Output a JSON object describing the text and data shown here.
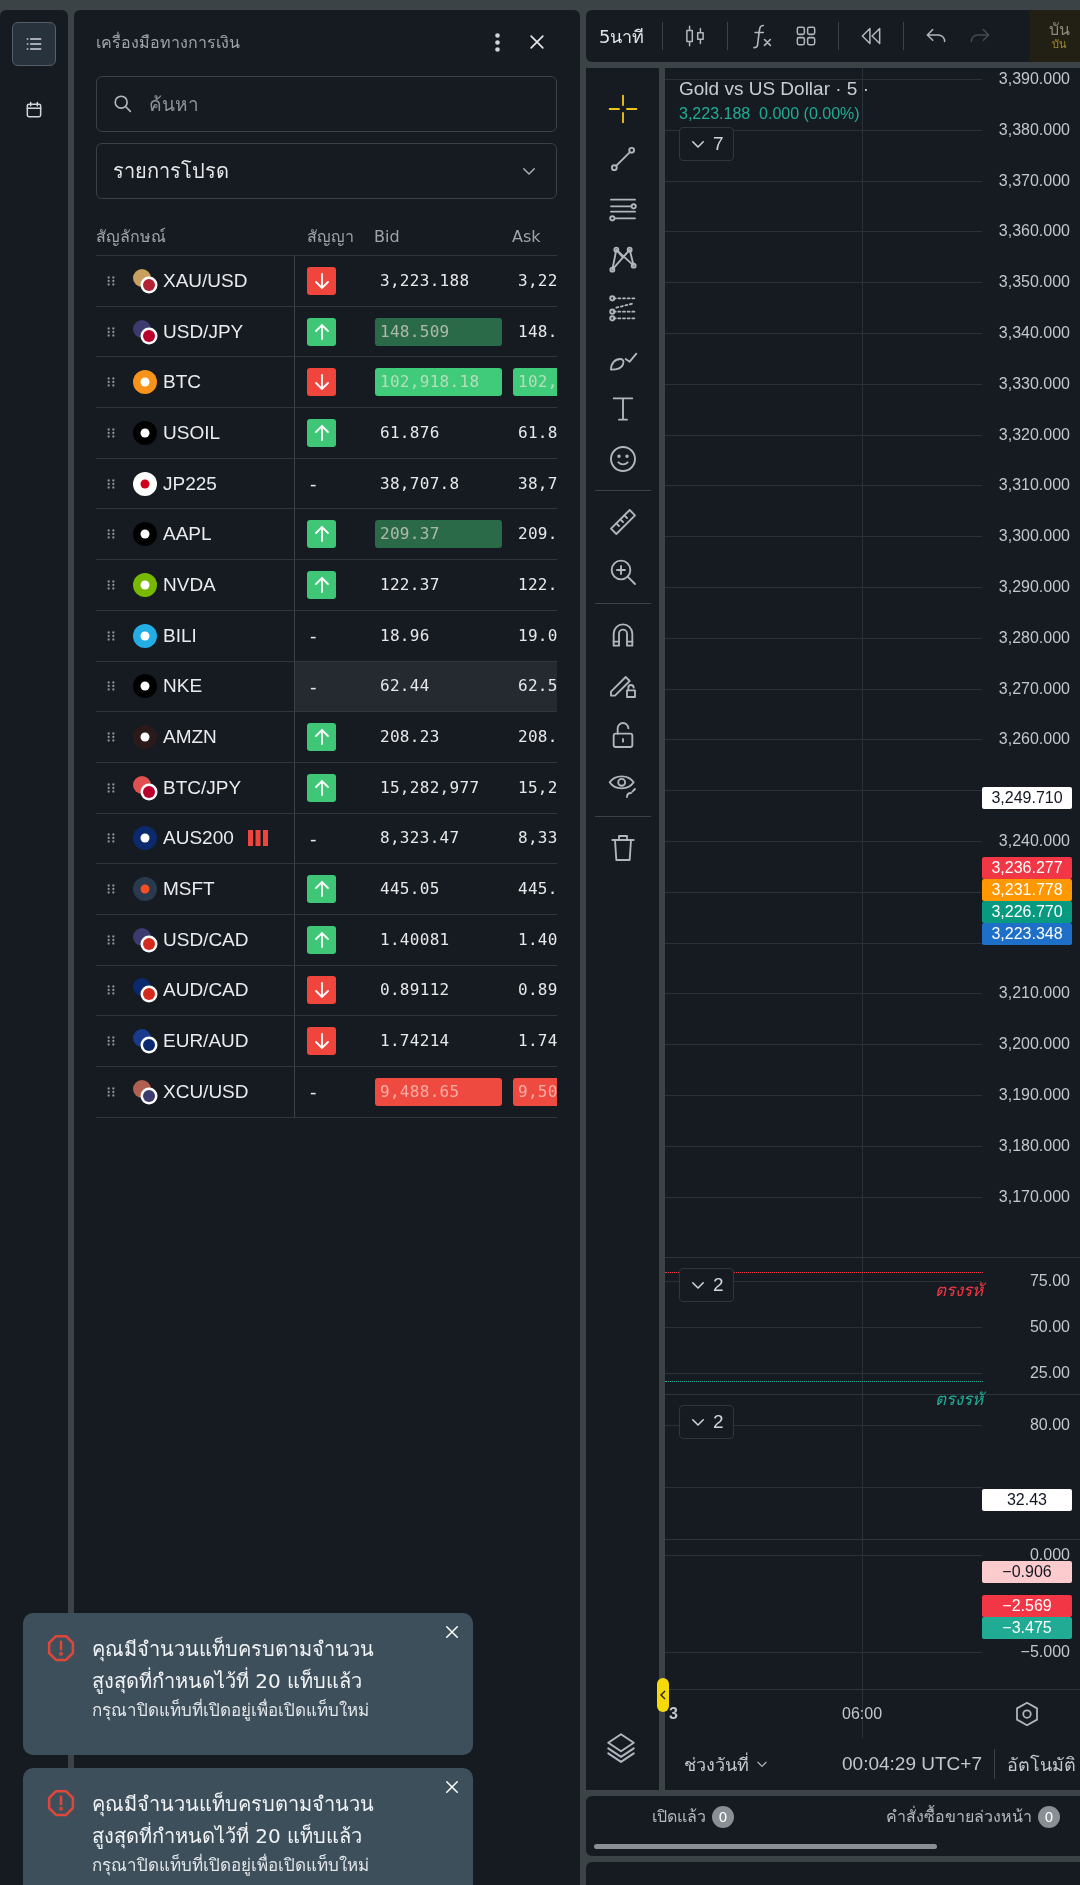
{
  "rail": [
    {
      "kind": "list",
      "selected": true
    },
    {
      "kind": "calendar",
      "selected": false
    }
  ],
  "watchlist": {
    "title": "เครื่องมือทางการเงิน",
    "search": {
      "placeholder": "ค้นหา"
    },
    "list_name": "รายการโปรด",
    "columns": [
      "สัญลักษณ์",
      "สัญญา",
      "Bid",
      "Ask"
    ],
    "rows": [
      {
        "symbol": "XAU/USD",
        "signal": {
          "kind": "down"
        },
        "bid": {
          "text": "3,223.188"
        },
        "ask": {
          "text": "3,22"
        },
        "closed": false,
        "hovered": false
      },
      {
        "symbol": "USD/JPY",
        "signal": {
          "kind": "up"
        },
        "bid": {
          "text": "148.509",
          "color": "#2a6a48"
        },
        "ask": {
          "text": "148."
        },
        "closed": false,
        "hovered": false
      },
      {
        "symbol": "BTC",
        "signal": {
          "kind": "down"
        },
        "bid": {
          "text": "102,918.18",
          "color": "#3fcb79"
        },
        "ask": {
          "text": "102,",
          "color": "#3fcb79"
        },
        "closed": false,
        "hovered": false
      },
      {
        "symbol": "USOIL",
        "signal": {
          "kind": "up"
        },
        "bid": {
          "text": "61.876"
        },
        "ask": {
          "text": "61.8"
        },
        "closed": false,
        "hovered": false
      },
      {
        "symbol": "JP225",
        "signal": {
          "kind": "none",
          "text": "-"
        },
        "bid": {
          "text": "38,707.8"
        },
        "ask": {
          "text": "38,7"
        },
        "closed": false,
        "hovered": false
      },
      {
        "symbol": "AAPL",
        "signal": {
          "kind": "up"
        },
        "bid": {
          "text": "209.37",
          "color": "#2a6a48"
        },
        "ask": {
          "text": "209."
        },
        "closed": false,
        "hovered": false
      },
      {
        "symbol": "NVDA",
        "signal": {
          "kind": "up"
        },
        "bid": {
          "text": "122.37"
        },
        "ask": {
          "text": "122."
        },
        "closed": false,
        "hovered": false
      },
      {
        "symbol": "BILI",
        "signal": {
          "kind": "none",
          "text": "-"
        },
        "bid": {
          "text": "18.96"
        },
        "ask": {
          "text": "19.0"
        },
        "closed": false,
        "hovered": false
      },
      {
        "symbol": "NKE",
        "signal": {
          "kind": "none",
          "text": "-"
        },
        "bid": {
          "text": "62.44"
        },
        "ask": {
          "text": "62.5"
        },
        "closed": false,
        "hovered": true
      },
      {
        "symbol": "AMZN",
        "signal": {
          "kind": "up"
        },
        "bid": {
          "text": "208.23"
        },
        "ask": {
          "text": "208."
        },
        "closed": false,
        "hovered": false
      },
      {
        "symbol": "BTC/JPY",
        "signal": {
          "kind": "up"
        },
        "bid": {
          "text": "15,282,977"
        },
        "ask": {
          "text": "15,2"
        },
        "closed": false,
        "hovered": false
      },
      {
        "symbol": "AUS200",
        "signal": {
          "kind": "none",
          "text": "-"
        },
        "bid": {
          "text": "8,323.47"
        },
        "ask": {
          "text": "8,33"
        },
        "closed": true,
        "hovered": false
      },
      {
        "symbol": "MSFT",
        "signal": {
          "kind": "up"
        },
        "bid": {
          "text": "445.05"
        },
        "ask": {
          "text": "445."
        },
        "closed": false,
        "hovered": false
      },
      {
        "symbol": "USD/CAD",
        "signal": {
          "kind": "up"
        },
        "bid": {
          "text": "1.40081"
        },
        "ask": {
          "text": "1.40"
        },
        "closed": false,
        "hovered": false
      },
      {
        "symbol": "AUD/CAD",
        "signal": {
          "kind": "down"
        },
        "bid": {
          "text": "0.89112"
        },
        "ask": {
          "text": "0.89"
        },
        "closed": false,
        "hovered": false
      },
      {
        "symbol": "EUR/AUD",
        "signal": {
          "kind": "down"
        },
        "bid": {
          "text": "1.74214"
        },
        "ask": {
          "text": "1.74"
        },
        "closed": false,
        "hovered": false
      },
      {
        "symbol": "XCU/USD",
        "signal": {
          "kind": "none",
          "text": "-"
        },
        "bid": {
          "text": "9,488.65",
          "color": "#ef4a3f"
        },
        "ask": {
          "text": "9,50",
          "color": "#ef4a3f"
        },
        "closed": false,
        "hovered": false
      }
    ]
  },
  "toasts": [
    {
      "title": "คุณมีจำนวนแท็บครบตามจำนวนสูงสุดที่กำหนดไว้ที่ 20 แท็บแล้ว",
      "message": "กรุณาปิดแท็บที่เปิดอยู่เพื่อเปิดแท็บใหม่"
    },
    {
      "title": "คุณมีจำนวนแท็บครบตามจำนวนสูงสุดที่กำหนดไว้ที่ 20 แท็บแล้ว",
      "message": "กรุณาปิดแท็บที่เปิดอยู่เพื่อเปิดแท็บใหม่"
    }
  ],
  "toolbar": {
    "interval": "5นาที",
    "redo_disabled": true,
    "save": [
      "บัน",
      "บัน"
    ]
  },
  "tool_groups": [
    [
      {
        "kind": "crosshair",
        "selected": true
      },
      {
        "kind": "line",
        "selected": false
      },
      {
        "kind": "fib",
        "selected": false
      },
      {
        "kind": "pattern",
        "selected": false
      },
      {
        "kind": "projection",
        "selected": false
      },
      {
        "kind": "brush",
        "selected": false
      },
      {
        "kind": "text",
        "selected": false
      },
      {
        "kind": "emoji",
        "selected": false
      }
    ],
    [
      {
        "kind": "ruler",
        "selected": false
      },
      {
        "kind": "zoom",
        "selected": false
      }
    ],
    [
      {
        "kind": "magnet",
        "selected": false
      },
      {
        "kind": "pencil_lock",
        "selected": false
      },
      {
        "kind": "lock",
        "selected": false
      },
      {
        "kind": "eye",
        "selected": false
      }
    ],
    [
      {
        "kind": "trash",
        "selected": false
      }
    ]
  ],
  "chart": {
    "title": "Gold vs US Dollar · 5 ·",
    "price": "3,223.188",
    "change": "0.000 (0.00%)",
    "panes": [
      {
        "toggle": "7",
        "axis": [
          [
            "3,390.000",
            "3,380.000",
            "3,370.000",
            "3,360.000",
            "3,350.000",
            "3,340.000",
            "3,330.000",
            "3,320.000",
            "3,310.000",
            "3,300.000",
            "3,290.000",
            "3,280.000",
            "3,270.000",
            "3,260.000"
          ],
          [
            "3,240.000"
          ],
          [
            "3,210.000",
            "3,200.000",
            "3,190.000",
            "3,180.000",
            "3,170.000"
          ]
        ],
        "tags": [
          {
            "text": "3,249.710",
            "color": "#ffffff"
          },
          {
            "text": "3,236.277",
            "color": "#f23645"
          },
          {
            "text": "3,231.778",
            "color": "#ff9800"
          },
          {
            "text": "3,226.770",
            "color": "#089981"
          },
          {
            "text": "3,223.348",
            "color": "#1e6fc8"
          }
        ]
      },
      {
        "toggle": "2",
        "axis": [
          [
            "75.00",
            "50.00",
            "25.00"
          ]
        ],
        "levels": [
          {
            "text": "ตรงรหั",
            "color": "#f23645"
          },
          {
            "text": "ตรงรหั",
            "color": "#22ab94"
          }
        ]
      },
      {
        "toggle": "2",
        "axis": [
          [
            "80.00"
          ]
        ],
        "tags": [
          {
            "text": "32.43",
            "color": "#ffffff"
          }
        ]
      },
      {
        "axis": [
          [
            "0.000",
            "−5.000"
          ]
        ],
        "tags": [
          {
            "text": "−0.906",
            "color": "#fccbcd"
          },
          {
            "text": "−2.569",
            "color": "#f23645"
          },
          {
            "text": "−3.475",
            "color": "#22ab94"
          }
        ]
      }
    ],
    "time_axis": [
      "3",
      "06:00"
    ],
    "date_range": "ช่วงวันที่",
    "clock": "00:04:29 UTC+7",
    "scale_mode": "อัตโนมัติ"
  },
  "bottom_tabs": [
    {
      "label": "เปิดแล้ว",
      "count": "0"
    },
    {
      "label": "คำสั่งซื้อขายล่วงหน้า",
      "count": "0"
    }
  ]
}
